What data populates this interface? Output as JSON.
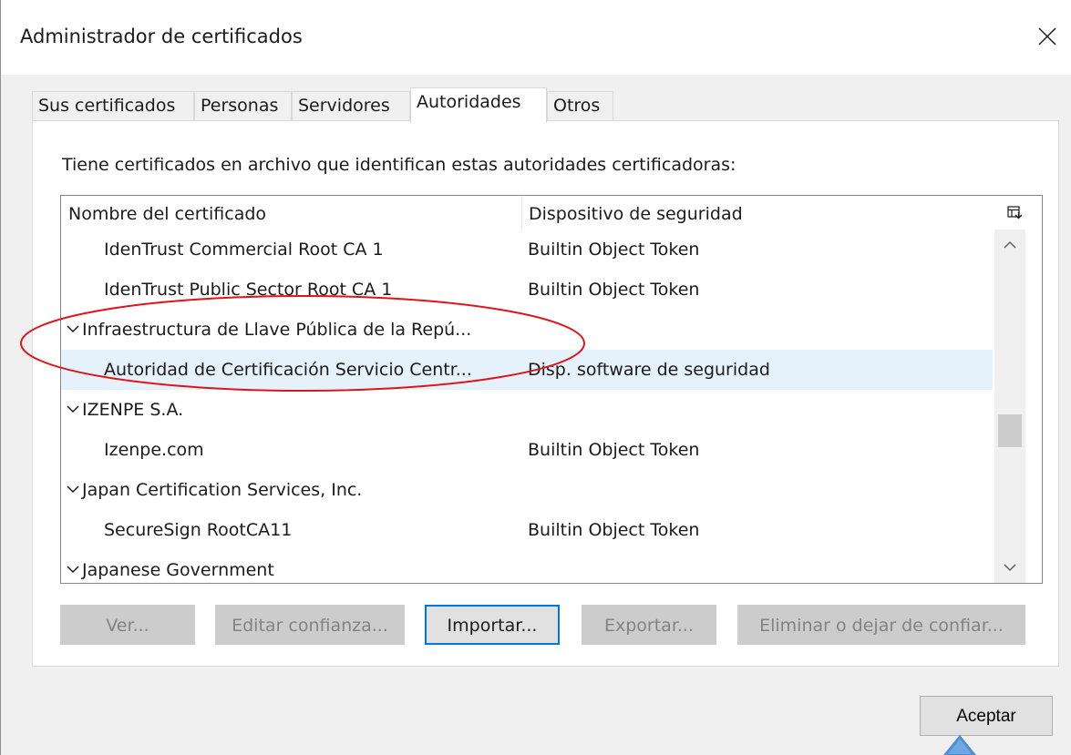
{
  "window": {
    "title": "Administrador de certificados",
    "close_icon": "close-icon"
  },
  "tabs": [
    {
      "label": "Sus certificados",
      "active": false
    },
    {
      "label": "Personas",
      "active": false
    },
    {
      "label": "Servidores",
      "active": false
    },
    {
      "label": "Autoridades",
      "active": true
    },
    {
      "label": "Otros",
      "active": false
    }
  ],
  "panel": {
    "description": "Tiene certificados en archivo que identifican estas autoridades certificadoras:"
  },
  "table": {
    "columns": [
      "Nombre del certificado",
      "Dispositivo de seguridad"
    ],
    "rows": [
      {
        "name": "IdenTrust Commercial Root CA 1",
        "device": "Builtin Object Token",
        "group": false
      },
      {
        "name": "IdenTrust Public Sector Root CA 1",
        "device": "Builtin Object Token",
        "group": false
      },
      {
        "name": "Infraestructura de Llave Pública de la Repú...",
        "device": "",
        "group": true
      },
      {
        "name": "Autoridad de Certificación Servicio Centr...",
        "device": "Disp. software de seguridad",
        "group": false,
        "selected": true
      },
      {
        "name": "IZENPE S.A.",
        "device": "",
        "group": true
      },
      {
        "name": "Izenpe.com",
        "device": "Builtin Object Token",
        "group": false
      },
      {
        "name": "Japan Certification Services, Inc.",
        "device": "",
        "group": true
      },
      {
        "name": "SecureSign RootCA11",
        "device": "Builtin Object Token",
        "group": false
      },
      {
        "name": "Japanese Government",
        "device": "",
        "group": true
      }
    ]
  },
  "buttons": {
    "view": "Ver...",
    "edit_trust": "Editar confianza...",
    "import": "Importar...",
    "export": "Exportar...",
    "delete": "Eliminar o dejar de confiar...",
    "accept": "Aceptar"
  },
  "colors": {
    "selection": "#e5f1fb",
    "annotation_ellipse": "#e0141b",
    "annotation_arrow": "#4a8fd4",
    "focus_border": "#0078d7"
  }
}
